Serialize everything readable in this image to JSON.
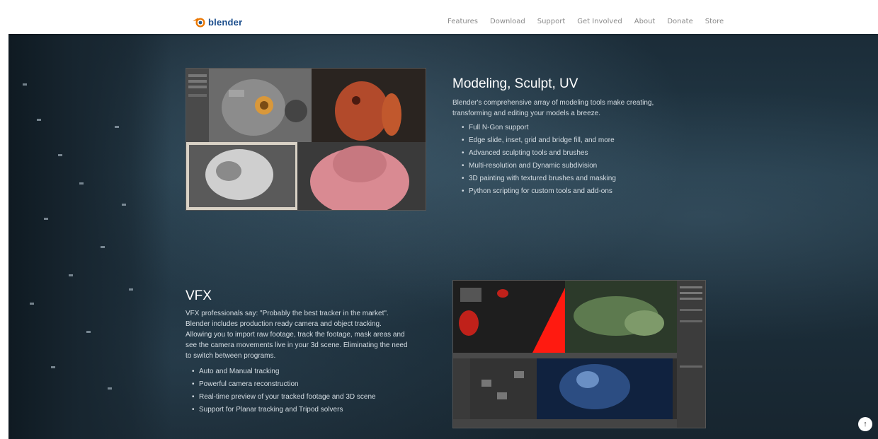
{
  "brand": {
    "logo_text": "blender"
  },
  "nav": {
    "items": [
      "Features",
      "Download",
      "Support",
      "Get Involved",
      "About",
      "Donate",
      "Store"
    ]
  },
  "modeling": {
    "title": "Modeling, Sculpt, UV",
    "description": "Blender's comprehensive array of modeling tools make creating, transforming and editing your models a breeze.",
    "features": [
      "Full N-Gon support",
      "Edge slide, inset, grid and bridge fill, and more",
      "Advanced sculpting tools and brushes",
      "Multi-resolution and Dynamic subdivision",
      "3D painting with textured brushes and masking",
      "Python scripting for custom tools and add-ons"
    ]
  },
  "vfx": {
    "title": "VFX",
    "description": "VFX professionals say: \"Probably the best tracker in the market\". Blender includes production ready camera and object tracking. Allowing you to import raw footage, track the footage, mask areas and see the camera movements live in your 3d scene. Eliminating the need to switch between programs.",
    "features": [
      "Auto and Manual tracking",
      "Powerful camera reconstruction",
      "Real-time preview of your tracked footage and 3D scene",
      "Support for Planar tracking and Tripod solvers"
    ]
  },
  "colors": {
    "header_bg": "#ffffff",
    "hero_bg": "#1f3340",
    "logo_blue": "#1a4d8c",
    "logo_orange": "#ea7600"
  },
  "icons": {
    "scroll_top": "arrow-up-icon",
    "scroll_down": "chevron-down-icon"
  }
}
